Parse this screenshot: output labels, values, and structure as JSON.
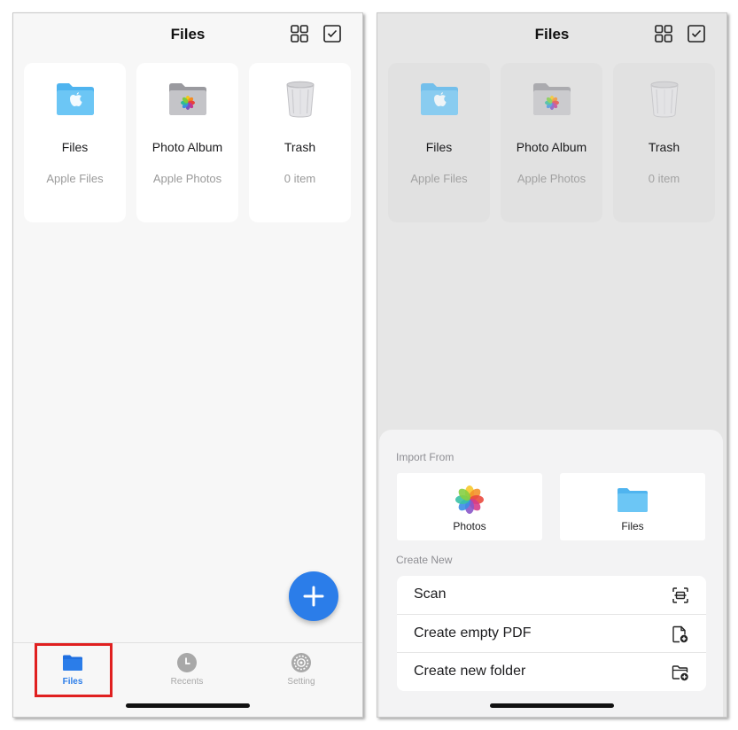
{
  "left_screen": {
    "header": {
      "title": "Files",
      "grid_icon": "grid-view-icon",
      "select_icon": "checkbox-select-icon"
    },
    "cards": [
      {
        "title": "Files",
        "subtitle": "Apple Files",
        "icon": "blue-folder-apple-icon"
      },
      {
        "title": "Photo Album",
        "subtitle": "Apple Photos",
        "icon": "gray-folder-photos-icon"
      },
      {
        "title": "Trash",
        "subtitle": "0 item",
        "icon": "trash-bin-icon"
      }
    ],
    "fab": {
      "icon": "plus-icon"
    },
    "tabbar": {
      "tabs": [
        {
          "label": "Files",
          "icon": "folder-icon",
          "selected": true
        },
        {
          "label": "Recents",
          "icon": "clock-icon",
          "selected": false
        },
        {
          "label": "Setting",
          "icon": "gear-icon",
          "selected": false
        }
      ]
    }
  },
  "right_screen": {
    "header": {
      "title": "Files",
      "grid_icon": "grid-view-icon",
      "select_icon": "checkbox-select-icon"
    },
    "cards": [
      {
        "title": "Files",
        "subtitle": "Apple Files",
        "icon": "blue-folder-apple-icon"
      },
      {
        "title": "Photo Album",
        "subtitle": "Apple Photos",
        "icon": "gray-folder-photos-icon"
      },
      {
        "title": "Trash",
        "subtitle": "0 item",
        "icon": "trash-bin-icon"
      }
    ],
    "sheet": {
      "import_label": "Import From",
      "import_options": [
        {
          "label": "Photos",
          "icon": "photos-app-icon"
        },
        {
          "label": "Files",
          "icon": "files-folder-icon"
        }
      ],
      "create_label": "Create New",
      "actions": [
        {
          "label": "Scan",
          "icon": "scan-icon"
        },
        {
          "label": "Create empty PDF",
          "icon": "new-document-icon"
        },
        {
          "label": "Create new folder",
          "icon": "new-folder-icon"
        }
      ]
    }
  },
  "colors": {
    "accent": "#2b7de9",
    "highlight_border": "#e02020",
    "folder_blue": "#5ac8fa",
    "inactive_tab": "#a8a8a8"
  }
}
